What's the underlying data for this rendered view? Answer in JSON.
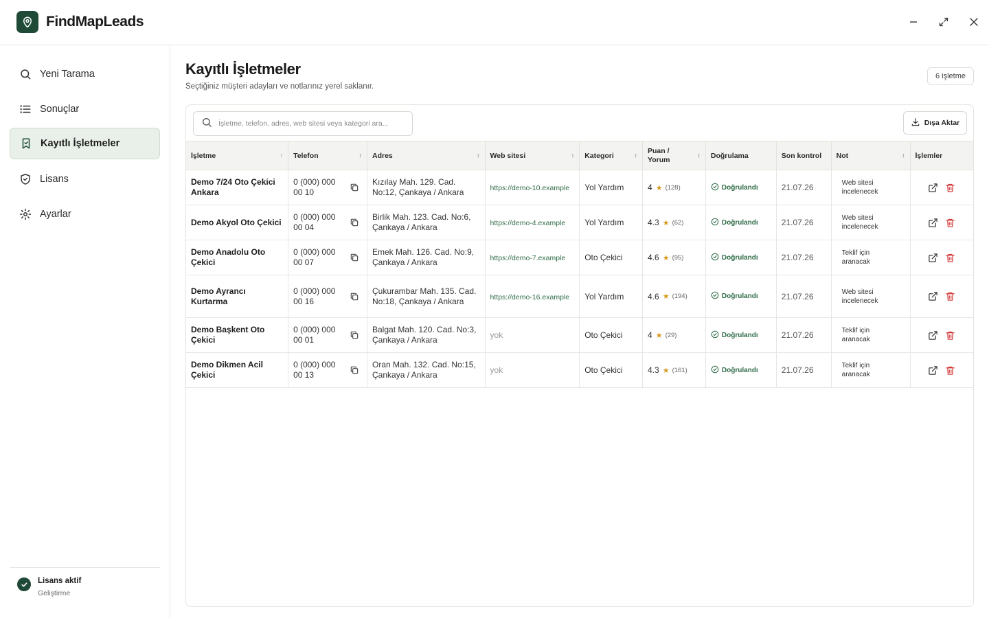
{
  "app": {
    "name": "FindMapLeads"
  },
  "window": {
    "minimize_icon": "minimize-icon",
    "maximize_icon": "maximize-icon",
    "close_icon": "close-icon"
  },
  "sidebar": {
    "items": [
      {
        "label": "Yeni Tarama",
        "icon": "search-icon",
        "active": false
      },
      {
        "label": "Sonuçlar",
        "icon": "list-icon",
        "active": false
      },
      {
        "label": "Kayıtlı İşletmeler",
        "icon": "bookmark-icon",
        "active": true
      },
      {
        "label": "Lisans",
        "icon": "shield-check-icon",
        "active": false
      },
      {
        "label": "Ayarlar",
        "icon": "gear-icon",
        "active": false
      }
    ],
    "license": {
      "title": "Lisans aktif",
      "subtitle": "Geliştirme"
    }
  },
  "main": {
    "title": "Kayıtlı İşletmeler",
    "subtitle": "Seçtiğiniz müşteri adayları ve notlarınız yerel saklanır.",
    "count_badge": "6 işletme",
    "search": {
      "placeholder": "İşletme, telefon, adres, web sitesi veya kategori ara...",
      "value": ""
    },
    "export_label": "Dışa Aktar"
  },
  "table": {
    "columns": {
      "name": "İşletme",
      "phone": "Telefon",
      "address": "Adres",
      "website": "Web sitesi",
      "category": "Kategori",
      "rating": "Puan / Yorum",
      "verification": "Doğrulama",
      "last_check": "Son kontrol",
      "note": "Not",
      "actions": "İşlemler"
    },
    "rows": [
      {
        "name": "Demo 7/24 Oto Çekici Ankara",
        "phone": "0 (000) 000 00 10",
        "address": "Kızılay Mah. 129. Cad. No:12, Çankaya / Ankara",
        "website": "https://demo-10.example",
        "category": "Yol Yardım",
        "rating": "4",
        "reviews": "(128)",
        "verification": "Doğrulandı",
        "last_check": "21.07.26",
        "note": "Web sitesi incelenecek"
      },
      {
        "name": "Demo Akyol Oto Çekici",
        "phone": "0 (000) 000 00 04",
        "address": "Birlik Mah. 123. Cad. No:6, Çankaya / Ankara",
        "website": "https://demo-4.example",
        "category": "Yol Yardım",
        "rating": "4.3",
        "reviews": "(62)",
        "verification": "Doğrulandı",
        "last_check": "21.07.26",
        "note": "Web sitesi incelenecek"
      },
      {
        "name": "Demo Anadolu Oto Çekici",
        "phone": "0 (000) 000 00 07",
        "address": "Emek Mah. 126. Cad. No:9, Çankaya / Ankara",
        "website": "https://demo-7.example",
        "category": "Oto Çekici",
        "rating": "4.6",
        "reviews": "(95)",
        "verification": "Doğrulandı",
        "last_check": "21.07.26",
        "note": "Teklif için aranacak"
      },
      {
        "name": "Demo Ayrancı Kurtarma",
        "phone": "0 (000) 000 00 16",
        "address": "Çukurambar Mah. 135. Cad. No:18, Çankaya / Ankara",
        "website": "https://demo-16.example",
        "category": "Yol Yardım",
        "rating": "4.6",
        "reviews": "(194)",
        "verification": "Doğrulandı",
        "last_check": "21.07.26",
        "note": "Web sitesi incelenecek"
      },
      {
        "name": "Demo Başkent Oto Çekici",
        "phone": "0 (000) 000 00 01",
        "address": "Balgat Mah. 120. Cad. No:3, Çankaya / Ankara",
        "website": "yok",
        "category": "Oto Çekici",
        "rating": "4",
        "reviews": "(29)",
        "verification": "Doğrulandı",
        "last_check": "21.07.26",
        "note": "Teklif için aranacak"
      },
      {
        "name": "Demo Dikmen Acil Çekici",
        "phone": "0 (000) 000 00 13",
        "address": "Oran Mah. 132. Cad. No:15, Çankaya / Ankara",
        "website": "yok",
        "category": "Oto Çekici",
        "rating": "4.3",
        "reviews": "(161)",
        "verification": "Doğrulandı",
        "last_check": "21.07.26",
        "note": "Teklif için aranacak"
      }
    ]
  },
  "colors": {
    "brand": "#1e4a37",
    "active_nav_bg": "#e8f0e9",
    "link": "#2e6b46",
    "star": "#d79a1b",
    "delete": "#d33b3b"
  }
}
